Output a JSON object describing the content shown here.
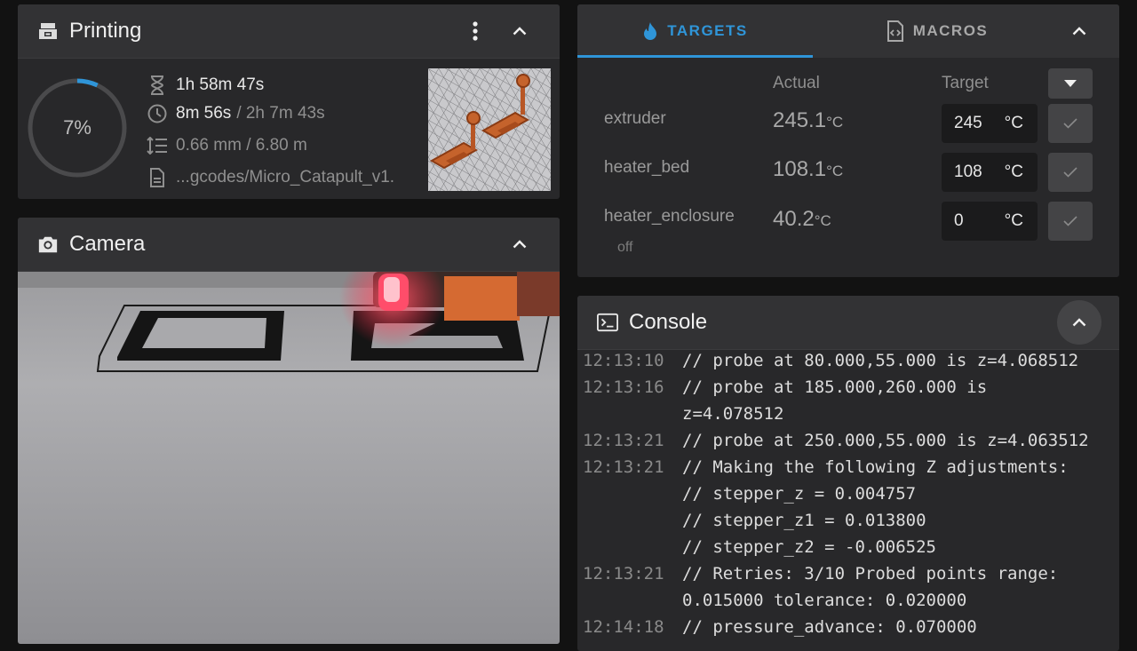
{
  "printing": {
    "title": "Printing",
    "progress_percent": 7,
    "progress_label": "7%",
    "elapsed": "1h 58m 47s",
    "remaining": "8m 56s",
    "total_estimate": "/ 2h 7m 43s",
    "layer_height": "0.66 mm / 6.80 m",
    "filename": "...gcodes/Micro_Catapult_v1.",
    "accent_color": "#2f95d8"
  },
  "camera": {
    "title": "Camera"
  },
  "targets": {
    "tabs": [
      {
        "label": "TARGETS",
        "icon": "fire-icon",
        "active": true
      },
      {
        "label": "MACROS",
        "icon": "code-file-icon",
        "active": false
      }
    ],
    "col_actual": "Actual",
    "col_target": "Target",
    "heaters": [
      {
        "name": "extruder",
        "actual": "245.1",
        "unit": "°C",
        "target": "245",
        "target_unit": "°C"
      },
      {
        "name": "heater_bed",
        "actual": "108.1",
        "unit": "°C",
        "target": "108",
        "target_unit": "°C"
      },
      {
        "name": "heater_enclosure",
        "actual": "40.2",
        "unit": "°C",
        "target": "0",
        "target_unit": "°C",
        "status": "off"
      }
    ]
  },
  "console": {
    "title": "Console",
    "entries": [
      {
        "time": "12:13:10",
        "lines": [
          "// probe at 80.000,55.000 is z=4.068512"
        ]
      },
      {
        "time": "12:13:16",
        "lines": [
          "// probe at 185.000,260.000 is",
          "z=4.078512"
        ]
      },
      {
        "time": "12:13:21",
        "lines": [
          "// probe at 250.000,55.000 is z=4.063512"
        ]
      },
      {
        "time": "12:13:21",
        "lines": [
          "// Making the following Z adjustments:",
          "// stepper_z = 0.004757",
          "// stepper_z1 = 0.013800",
          "// stepper_z2 = -0.006525"
        ]
      },
      {
        "time": "12:13:21",
        "lines": [
          "// Retries: 3/10 Probed points range:",
          "0.015000 tolerance: 0.020000"
        ]
      },
      {
        "time": "12:14:18",
        "lines": [
          "// pressure_advance: 0.070000"
        ]
      }
    ]
  }
}
